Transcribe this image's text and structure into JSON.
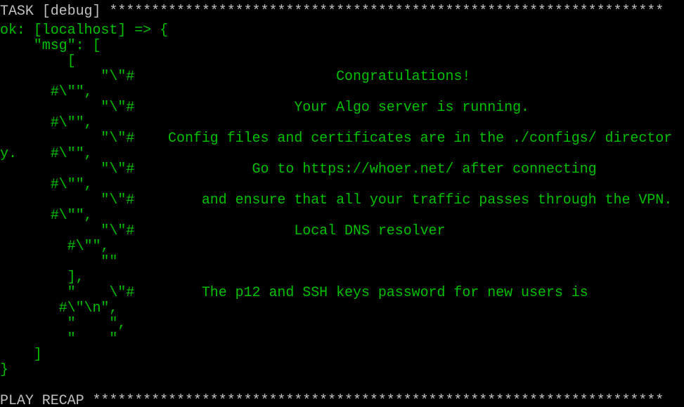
{
  "colors": {
    "background": "#000000",
    "header_text": "#c0c0c0",
    "output_text": "#00c000"
  },
  "terminal": {
    "lines": [
      {
        "text": "TASK [debug] ******************************************************************",
        "style": "gray"
      },
      {
        "text": "ok: [localhost] => {",
        "style": "green"
      },
      {
        "text": "    \"msg\": [",
        "style": "green"
      },
      {
        "text": "        [",
        "style": "green"
      },
      {
        "text": "            \"\\\"#                        Congratulations!",
        "style": "green"
      },
      {
        "text": "      #\\\"\",",
        "style": "green"
      },
      {
        "text": "            \"\\\"#                   Your Algo server is running.",
        "style": "green"
      },
      {
        "text": "      #\\\"\",",
        "style": "green"
      },
      {
        "text": "            \"\\\"#    Config files and certificates are in the ./configs/ director",
        "style": "green"
      },
      {
        "text": "y.    #\\\"\",",
        "style": "green"
      },
      {
        "text": "            \"\\\"#              Go to https://whoer.net/ after connecting",
        "style": "green"
      },
      {
        "text": "      #\\\"\",",
        "style": "green"
      },
      {
        "text": "            \"\\\"#        and ensure that all your traffic passes through the VPN.",
        "style": "green"
      },
      {
        "text": "      #\\\"\",",
        "style": "green"
      },
      {
        "text": "            \"\\\"#                   Local DNS resolver",
        "style": "green"
      },
      {
        "text": "        #\\\"\",",
        "style": "green"
      },
      {
        "text": "            \"\"",
        "style": "green"
      },
      {
        "text": "        ],",
        "style": "green"
      },
      {
        "text": "        \"    \\\"#        The p12 and SSH keys password for new users is",
        "style": "green"
      },
      {
        "text": "       #\\\"\\n\",",
        "style": "green"
      },
      {
        "text": "        \"    \",",
        "style": "green"
      },
      {
        "text": "        \"    \"",
        "style": "green"
      },
      {
        "text": "    ]",
        "style": "green"
      },
      {
        "text": "}",
        "style": "green"
      },
      {
        "text": "",
        "style": "gray"
      },
      {
        "text": "PLAY RECAP ********************************************************************",
        "style": "gray"
      }
    ]
  }
}
